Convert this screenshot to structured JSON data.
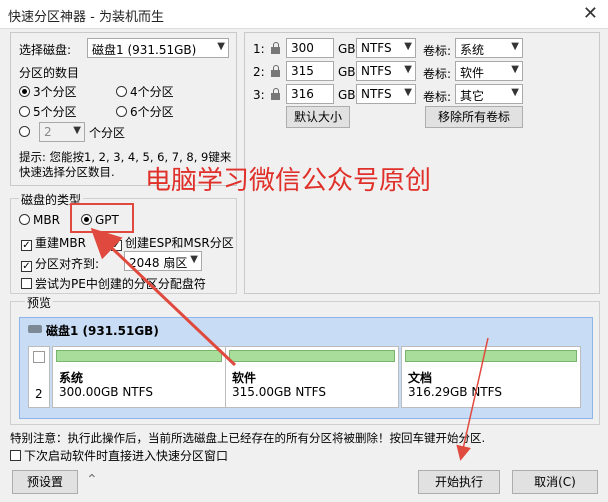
{
  "window": {
    "title": "快速分区神器 - 为装机而生",
    "close_glyph": "✕"
  },
  "left": {
    "select_disk_label": "选择磁盘:",
    "disk_value": "磁盘1 (931.51GB)",
    "count_label": "分区的数目",
    "opt3": "3个分区",
    "opt4": "4个分区",
    "opt5": "5个分区",
    "opt6": "6个分区",
    "custom_value": "2",
    "custom_suffix": "个分区",
    "tip_line1": "提示: 您能按1, 2, 3, 4, 5, 6, 7, 8, 9键来",
    "tip_line2": "快速选择分区数目."
  },
  "disktype": {
    "label": "磁盘的类型",
    "mbr": "MBR",
    "gpt": "GPT",
    "rebuild_mbr": "重建MBR",
    "create_esp": "创建ESP和MSR分区",
    "align_label": "分区对齐到:",
    "align_value": "2048 扇区",
    "pe_label": "尝试为PE中创建的分区分配盘符"
  },
  "partitions": [
    {
      "num": "1:",
      "size": "300",
      "unit": "GB",
      "fs": "NTFS",
      "vol_label": "卷标:",
      "vol": "系统"
    },
    {
      "num": "2:",
      "size": "315",
      "unit": "GB",
      "fs": "NTFS",
      "vol_label": "卷标:",
      "vol": "软件"
    },
    {
      "num": "3:",
      "size": "316",
      "unit": "GB",
      "fs": "NTFS",
      "vol_label": "卷标:",
      "vol": "其它"
    }
  ],
  "buttons": {
    "default_size": "默认大小",
    "remove_labels": "移除所有卷标",
    "preset": "预设置",
    "start": "开始执行",
    "cancel": "取消(C)"
  },
  "preview": {
    "label": "预览",
    "disk_title": "磁盘1 (931.51GB)",
    "index": "2",
    "parts": [
      {
        "name": "系统",
        "detail": "300.00GB NTFS"
      },
      {
        "name": "软件",
        "detail": "315.00GB NTFS"
      },
      {
        "name": "文档",
        "detail": "316.29GB NTFS"
      }
    ]
  },
  "footer": {
    "warning": "特别注意：执行此操作后，当前所选磁盘上已经存在的所有分区将被删除！按回车键开始分区.",
    "next_time": "下次启动软件时直接进入快速分区窗口"
  },
  "watermark": "电脑学习微信公众号原创",
  "colors": {
    "annotation_red": "#e04a3e",
    "bar_green": "#a9dd9b",
    "disk_blue": "#c8dcf5"
  }
}
